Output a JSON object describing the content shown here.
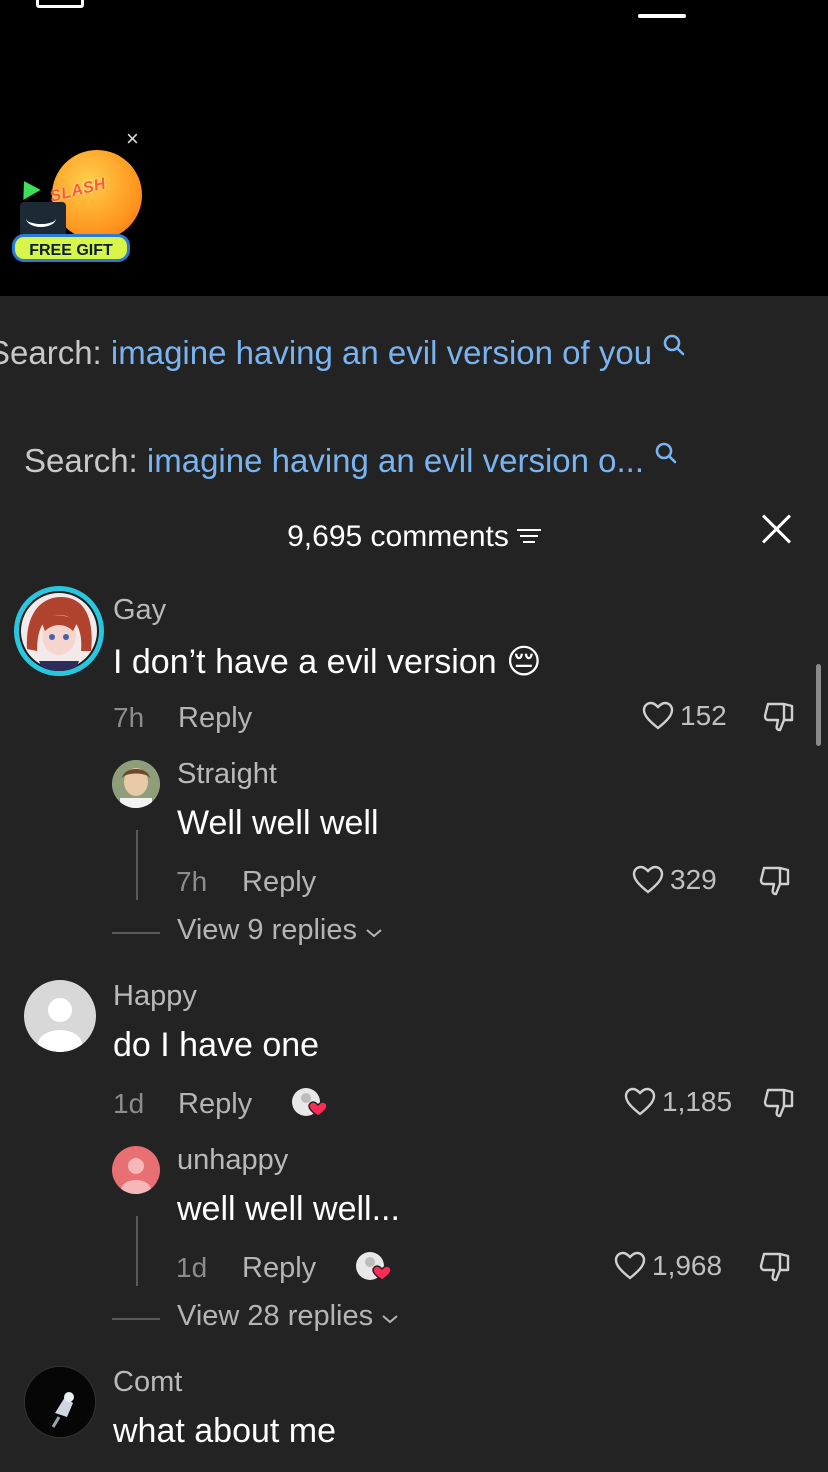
{
  "ad": {
    "badge_text": "FREE GIFT",
    "brand_text": "SLASH",
    "close_glyph": "×"
  },
  "search": {
    "prefix": "Search:",
    "rows": [
      {
        "query": "imagine having an evil version of you"
      },
      {
        "query": "imagine having an evil version o..."
      }
    ]
  },
  "comments_header": {
    "count_label": "9,695 comments"
  },
  "comments": [
    {
      "username": "Gay",
      "text": "I don’t have a evil version 😔",
      "time": "7h",
      "reply_label": "Reply",
      "likes": "152",
      "avatar": "anime-avatar",
      "replies": [
        {
          "username": "Straight",
          "text": "Well well well",
          "time": "7h",
          "reply_label": "Reply",
          "likes": "329"
        }
      ],
      "view_replies": "View 9 replies"
    },
    {
      "username": "Happy",
      "text": "do I have one",
      "time": "1d",
      "reply_label": "Reply",
      "likes": "1,185",
      "avatar": "default-avatar",
      "creator_liked": true,
      "replies": [
        {
          "username": "unhappy",
          "text": "well well well...",
          "time": "1d",
          "reply_label": "Reply",
          "likes": "1,968",
          "creator_liked": true
        }
      ],
      "view_replies": "View 28 replies"
    },
    {
      "username": "Comt",
      "text": "what about me",
      "avatar": "dark-avatar"
    }
  ],
  "colors": {
    "sheet_bg": "#232323",
    "link_blue": "#79b4f0",
    "ring_cyan": "#28c7e0",
    "heart_red": "#fe2c55"
  }
}
